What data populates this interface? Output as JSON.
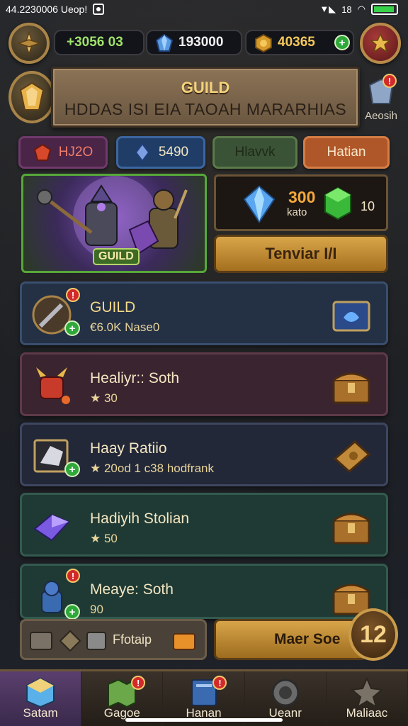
{
  "status_bar": {
    "time_carrier": "44.2230006 Ueop!",
    "signal": "▼◣",
    "wifi": "18"
  },
  "currency": {
    "gold_value": "+3056 03",
    "gem_value": "193000",
    "coin_value": "40365"
  },
  "guild_header": {
    "title": "GUILD",
    "subtitle": "HDDAS ISI EIA TAOAH MARARHIAS",
    "side_label": "Aeosih"
  },
  "tabs": [
    {
      "label": "HJ2O"
    },
    {
      "label": "5490"
    },
    {
      "label": "Hlavvk"
    },
    {
      "label": "Hatian"
    }
  ],
  "hero": {
    "tag": "GUILD"
  },
  "reward": {
    "amount": "300",
    "label": "kato",
    "second_amount": "10"
  },
  "action_button": {
    "label": "Tenviar I/I"
  },
  "quests": [
    {
      "title": "GUILD",
      "subtitle": "€6.0K Nase0"
    },
    {
      "title": "Healiyr:: Soth",
      "subtitle": "★ 30"
    },
    {
      "title": "Haay Ratiio",
      "subtitle": "★ 20od 1 c38 hodfrank"
    },
    {
      "title": "Hadiyih Stolian",
      "subtitle": "★ 50"
    },
    {
      "title": "Meaye: Soth",
      "subtitle": "90"
    }
  ],
  "footer": {
    "box_label": "Ffotaip",
    "button_label": "Maer Soe",
    "level": "12"
  },
  "nav": [
    {
      "label": "Satam",
      "active": true
    },
    {
      "label": "Gagoe",
      "active": false
    },
    {
      "label": "Hanan",
      "active": false
    },
    {
      "label": "Ueanr",
      "active": false
    },
    {
      "label": "Maliaac",
      "active": false
    }
  ],
  "colors": {
    "accent_gold": "#d8a54a",
    "tab1": "#5a2e5a",
    "tab2": "#254a7a",
    "tab3": "#3f5a3a",
    "tab4": "#b0572a"
  }
}
